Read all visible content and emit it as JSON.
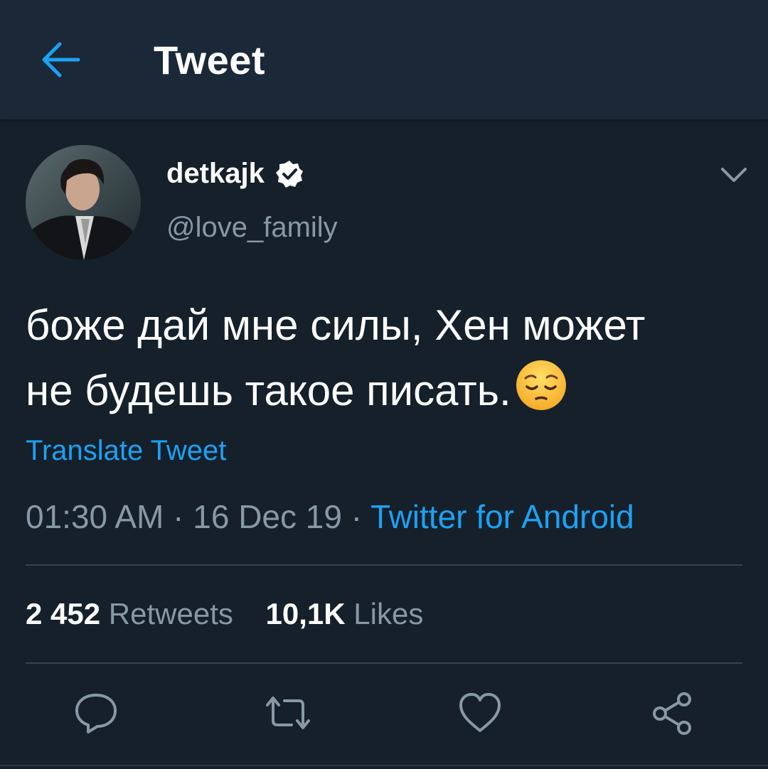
{
  "header": {
    "title": "Tweet",
    "back_icon": "arrow-left-icon"
  },
  "author": {
    "display_name": "detkajk",
    "handle": "@love_family",
    "verified": true
  },
  "tweet": {
    "line1": "боже дай мне силы, Хен может",
    "line2": "не будешь такое писать.",
    "emoji": "pensive-face-emoji",
    "translate_label": "Translate Tweet"
  },
  "meta": {
    "time": "01:30 AM",
    "sep1": " · ",
    "date": "16 Dec 19",
    "sep2": " · ",
    "source": "Twitter for Android"
  },
  "stats": {
    "retweets_count": "2 452",
    "retweets_label": "Retweets",
    "likes_count": "10,1K",
    "likes_label": "Likes"
  },
  "actions": [
    "reply-icon",
    "retweet-icon",
    "like-icon",
    "share-icon"
  ],
  "colors": {
    "background": "#15202b",
    "header": "#1b2837",
    "accent": "#1da1f2",
    "secondary_text": "#8899a6",
    "divider": "#38444d"
  }
}
